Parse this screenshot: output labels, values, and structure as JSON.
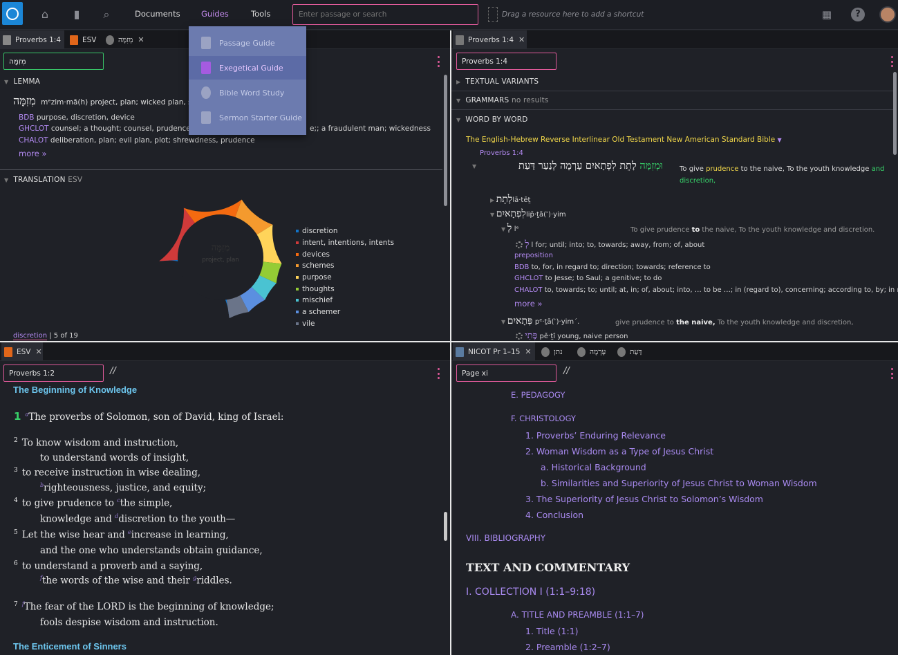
{
  "topbar": {
    "menu_documents": "Documents",
    "menu_guides": "Guides",
    "menu_tools": "Tools",
    "search_placeholder": "Enter passage or search",
    "shortcut_hint": "Drag a resource here to add a shortcut",
    "help_label": "?"
  },
  "guides_menu": {
    "items": [
      "Passage Guide",
      "Exegetical Guide",
      "Bible Word Study",
      "Sermon Starter Guide"
    ],
    "selected": "Exegetical Guide"
  },
  "panel_tl": {
    "tabs": [
      "Proverbs 1:4",
      "ESV",
      "מְזִמָּה"
    ],
    "input_value": "מְזִמָּה",
    "lemma_header": "LEMMA",
    "lemma_word": "מְזִמָּה",
    "lemma_gloss": "mᵉzim·mā(h) project, plan; wicked plan, scheme",
    "bdb_label": "BDB",
    "bdb_text": "purpose, discretion, device",
    "ghclot_label": "GHCLOT",
    "ghclot_text": "counsel; a thought; counsel, prudence, craft",
    "ghclot_tail": "e;; a fraudulent man; wickedness",
    "chalot_label": "CHALOT",
    "chalot_text": "deliberation, plan; evil plan, plot; shrewdness, prudence",
    "more": "more »",
    "translation_header": "TRANSLATION",
    "translation_version": "ESV",
    "donut_word": "מְזִמָּה",
    "donut_sub": "project, plan",
    "footer_word": "discretion",
    "footer_count": "| 5 of 19",
    "colors": {
      "accent": "#e05a9a",
      "link": "#b38af2"
    }
  },
  "chart_data": {
    "type": "pie",
    "categories": [
      "discretion",
      "intent, intentions, intents",
      "devices",
      "schemes",
      "purpose",
      "thoughts",
      "mischief",
      "a schemer",
      "vile"
    ],
    "values": [
      5,
      3,
      3,
      2,
      2,
      1,
      1,
      1,
      1
    ],
    "colors": [
      "#1274c9",
      "#cf3a3a",
      "#f46a10",
      "#f49a2e",
      "#ffd45a",
      "#94cc35",
      "#4ac3d2",
      "#5b8fe0",
      "#6a7489"
    ]
  },
  "panel_tr": {
    "tab": "Proverbs 1:4",
    "input_value": "Proverbs 1:4",
    "textual_variants": "TEXTUAL VARIANTS",
    "grammars": "GRAMMARS",
    "grammars_note": "no results",
    "word_by_word": "WORD BY WORD",
    "resource_title": "The English-Hebrew Reverse Interlinear Old Testament New American Standard Bible",
    "ref": "Proverbs 1:4",
    "hebrew_line_a": "לָתֵת לִפְתָאיִם עָרְמָה לְנַעַר דַּעַת",
    "hebrew_line_b": "וּמְזִמָּה",
    "eng_a": "To give",
    "eng_b": "prudence",
    "eng_c": "to the naive, To the youth knowledge",
    "eng_d": "and",
    "eng_e": "discretion,",
    "w1_heb": "לָתֵת",
    "w1_tr": "lā·tēṯ",
    "w2_heb": "לִפְתָאיִם",
    "w2_tr": "lip̄·ṯā(ʾ)·yim",
    "w3_heb": "לְ",
    "w3_tr": "lᵉ",
    "ctx_a": "To give prudence",
    "ctx_b": "to",
    "ctx_c": "the naive, To the youth knowledge and discretion.",
    "lamed_heb": "לְ",
    "lamed_gloss": "l for; until; into; to, towards; away, from; of, about",
    "pos": "preposition",
    "bdb_label": "BDB",
    "bdb_text": "to, for, in regard to; direction; towards; reference to",
    "ghclot_label": "GHCLOT",
    "ghclot_text": "to Jesse; to Saul; a genitive; to do",
    "chalot_label": "CHALOT",
    "chalot_text": "to, towards; to; until; at, in; of, about; into, … to be …; in (regard to), concerning; according to, by; in r...",
    "more": "more »",
    "w4_heb": "פְּתָאיִם",
    "w4_tr": "pᵉ·ṯā(ʾ)·yim´.",
    "ctx2_a": "give prudence to",
    "ctx2_b": "the naive,",
    "ctx2_c": "To the youth knowledge and discretion,",
    "w5_heb": "פֶּתִי",
    "w5_gloss": "pěˑṯî young, naive person"
  },
  "panel_bl": {
    "tab": "ESV",
    "input_value": "Proverbs 1:2",
    "slash": "//",
    "heading1": "The Beginning of Knowledge",
    "heading2": "The Enticement of Sinners",
    "lines": [
      {
        "n": "1",
        "fn": "a",
        "t": "The proverbs of Solomon, son of David, king of Israel:"
      },
      {
        "n": "2",
        "fn": "",
        "t": "To know wisdom and instruction,"
      },
      {
        "n": "",
        "fn": "",
        "t": "to understand words of insight,"
      },
      {
        "n": "3",
        "fn": "",
        "t": "to receive instruction in wise dealing,"
      },
      {
        "n": "",
        "fn": "b",
        "t": "righteousness, justice, and equity;"
      },
      {
        "n": "4",
        "fn": "c",
        "t": "the simple,",
        "pre": "to give prudence to "
      },
      {
        "n": "",
        "fn": "d",
        "t": "discretion to the youth—",
        "pre": "knowledge and "
      },
      {
        "n": "5",
        "fn": "e",
        "t": "increase in learning,",
        "pre": "Let the wise hear and "
      },
      {
        "n": "",
        "fn": "",
        "t": "and the one who understands obtain guidance,"
      },
      {
        "n": "6",
        "fn": "",
        "t": "to understand a proverb and a saying,"
      },
      {
        "n": "",
        "fn": "f",
        "t": "the words of the wise and their ",
        "fn2": "g",
        "t2": "riddles."
      },
      {
        "n": "7",
        "fn": "f",
        "t": "The fear of the LORD is the beginning of knowledge;"
      },
      {
        "n": "",
        "fn": "",
        "t": "fools despise wisdom and instruction."
      }
    ]
  },
  "panel_br": {
    "tabs": [
      "NICOT Pr 1–15",
      "נתן",
      "עָרְמָה",
      "דַּעַת"
    ],
    "input_value": "Page xi",
    "slash": "//",
    "toc": [
      "E. PEDAGOGY",
      "F. CHRISTOLOGY",
      "1. Proverbs’ Enduring Relevance",
      "2. Woman Wisdom as a Type of Jesus Christ",
      "a. Historical Background",
      "b. Similarities and Superiority of Jesus Christ to Woman Wisdom",
      "3. The Superiority of Jesus Christ to Solomon’s Wisdom",
      "4. Conclusion",
      "VIII. BIBLIOGRAPHY",
      "TEXT AND COMMENTARY",
      "I. COLLECTION I (1:1–9:18)",
      "A. TITLE AND PREAMBLE (1:1–7)",
      "1. Title (1:1)",
      "2. Preamble (1:2–7)"
    ]
  }
}
